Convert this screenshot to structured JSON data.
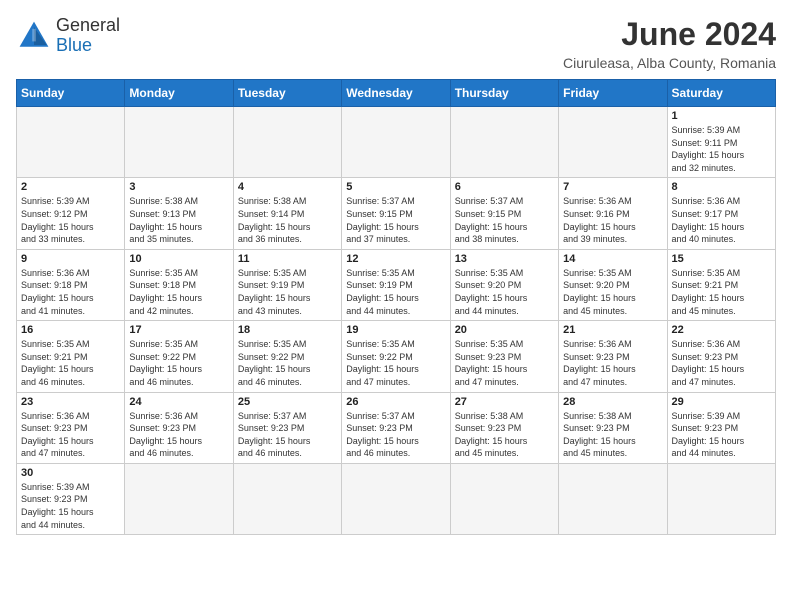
{
  "header": {
    "logo_general": "General",
    "logo_blue": "Blue",
    "title": "June 2024",
    "subtitle": "Ciuruleasa, Alba County, Romania"
  },
  "days_of_week": [
    "Sunday",
    "Monday",
    "Tuesday",
    "Wednesday",
    "Thursday",
    "Friday",
    "Saturday"
  ],
  "weeks": [
    [
      {
        "day": "",
        "info": "",
        "empty": true
      },
      {
        "day": "",
        "info": "",
        "empty": true
      },
      {
        "day": "",
        "info": "",
        "empty": true
      },
      {
        "day": "",
        "info": "",
        "empty": true
      },
      {
        "day": "",
        "info": "",
        "empty": true
      },
      {
        "day": "",
        "info": "",
        "empty": true
      },
      {
        "day": "1",
        "info": "Sunrise: 5:39 AM\nSunset: 9:11 PM\nDaylight: 15 hours\nand 32 minutes.",
        "empty": false
      }
    ],
    [
      {
        "day": "2",
        "info": "Sunrise: 5:39 AM\nSunset: 9:12 PM\nDaylight: 15 hours\nand 33 minutes.",
        "empty": false
      },
      {
        "day": "3",
        "info": "Sunrise: 5:38 AM\nSunset: 9:13 PM\nDaylight: 15 hours\nand 35 minutes.",
        "empty": false
      },
      {
        "day": "4",
        "info": "Sunrise: 5:38 AM\nSunset: 9:14 PM\nDaylight: 15 hours\nand 36 minutes.",
        "empty": false
      },
      {
        "day": "5",
        "info": "Sunrise: 5:37 AM\nSunset: 9:15 PM\nDaylight: 15 hours\nand 37 minutes.",
        "empty": false
      },
      {
        "day": "6",
        "info": "Sunrise: 5:37 AM\nSunset: 9:15 PM\nDaylight: 15 hours\nand 38 minutes.",
        "empty": false
      },
      {
        "day": "7",
        "info": "Sunrise: 5:36 AM\nSunset: 9:16 PM\nDaylight: 15 hours\nand 39 minutes.",
        "empty": false
      },
      {
        "day": "8",
        "info": "Sunrise: 5:36 AM\nSunset: 9:17 PM\nDaylight: 15 hours\nand 40 minutes.",
        "empty": false
      }
    ],
    [
      {
        "day": "9",
        "info": "Sunrise: 5:36 AM\nSunset: 9:18 PM\nDaylight: 15 hours\nand 41 minutes.",
        "empty": false
      },
      {
        "day": "10",
        "info": "Sunrise: 5:35 AM\nSunset: 9:18 PM\nDaylight: 15 hours\nand 42 minutes.",
        "empty": false
      },
      {
        "day": "11",
        "info": "Sunrise: 5:35 AM\nSunset: 9:19 PM\nDaylight: 15 hours\nand 43 minutes.",
        "empty": false
      },
      {
        "day": "12",
        "info": "Sunrise: 5:35 AM\nSunset: 9:19 PM\nDaylight: 15 hours\nand 44 minutes.",
        "empty": false
      },
      {
        "day": "13",
        "info": "Sunrise: 5:35 AM\nSunset: 9:20 PM\nDaylight: 15 hours\nand 44 minutes.",
        "empty": false
      },
      {
        "day": "14",
        "info": "Sunrise: 5:35 AM\nSunset: 9:20 PM\nDaylight: 15 hours\nand 45 minutes.",
        "empty": false
      },
      {
        "day": "15",
        "info": "Sunrise: 5:35 AM\nSunset: 9:21 PM\nDaylight: 15 hours\nand 45 minutes.",
        "empty": false
      }
    ],
    [
      {
        "day": "16",
        "info": "Sunrise: 5:35 AM\nSunset: 9:21 PM\nDaylight: 15 hours\nand 46 minutes.",
        "empty": false
      },
      {
        "day": "17",
        "info": "Sunrise: 5:35 AM\nSunset: 9:22 PM\nDaylight: 15 hours\nand 46 minutes.",
        "empty": false
      },
      {
        "day": "18",
        "info": "Sunrise: 5:35 AM\nSunset: 9:22 PM\nDaylight: 15 hours\nand 46 minutes.",
        "empty": false
      },
      {
        "day": "19",
        "info": "Sunrise: 5:35 AM\nSunset: 9:22 PM\nDaylight: 15 hours\nand 47 minutes.",
        "empty": false
      },
      {
        "day": "20",
        "info": "Sunrise: 5:35 AM\nSunset: 9:23 PM\nDaylight: 15 hours\nand 47 minutes.",
        "empty": false
      },
      {
        "day": "21",
        "info": "Sunrise: 5:36 AM\nSunset: 9:23 PM\nDaylight: 15 hours\nand 47 minutes.",
        "empty": false
      },
      {
        "day": "22",
        "info": "Sunrise: 5:36 AM\nSunset: 9:23 PM\nDaylight: 15 hours\nand 47 minutes.",
        "empty": false
      }
    ],
    [
      {
        "day": "23",
        "info": "Sunrise: 5:36 AM\nSunset: 9:23 PM\nDaylight: 15 hours\nand 47 minutes.",
        "empty": false
      },
      {
        "day": "24",
        "info": "Sunrise: 5:36 AM\nSunset: 9:23 PM\nDaylight: 15 hours\nand 46 minutes.",
        "empty": false
      },
      {
        "day": "25",
        "info": "Sunrise: 5:37 AM\nSunset: 9:23 PM\nDaylight: 15 hours\nand 46 minutes.",
        "empty": false
      },
      {
        "day": "26",
        "info": "Sunrise: 5:37 AM\nSunset: 9:23 PM\nDaylight: 15 hours\nand 46 minutes.",
        "empty": false
      },
      {
        "day": "27",
        "info": "Sunrise: 5:38 AM\nSunset: 9:23 PM\nDaylight: 15 hours\nand 45 minutes.",
        "empty": false
      },
      {
        "day": "28",
        "info": "Sunrise: 5:38 AM\nSunset: 9:23 PM\nDaylight: 15 hours\nand 45 minutes.",
        "empty": false
      },
      {
        "day": "29",
        "info": "Sunrise: 5:39 AM\nSunset: 9:23 PM\nDaylight: 15 hours\nand 44 minutes.",
        "empty": false
      }
    ],
    [
      {
        "day": "30",
        "info": "Sunrise: 5:39 AM\nSunset: 9:23 PM\nDaylight: 15 hours\nand 44 minutes.",
        "empty": false
      },
      {
        "day": "",
        "info": "",
        "empty": true
      },
      {
        "day": "",
        "info": "",
        "empty": true
      },
      {
        "day": "",
        "info": "",
        "empty": true
      },
      {
        "day": "",
        "info": "",
        "empty": true
      },
      {
        "day": "",
        "info": "",
        "empty": true
      },
      {
        "day": "",
        "info": "",
        "empty": true
      }
    ]
  ]
}
